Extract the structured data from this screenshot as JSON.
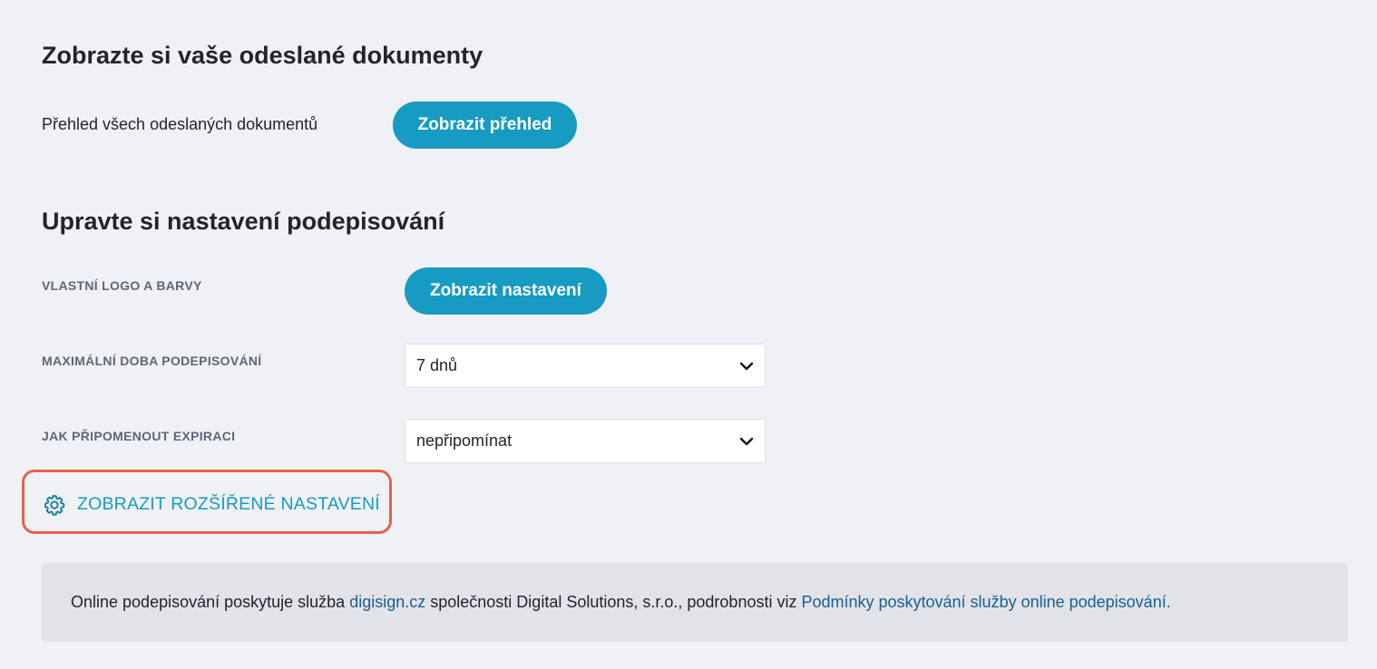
{
  "sent_docs": {
    "title": "Zobrazte si vaše odeslané dokumenty",
    "overview_label": "Přehled všech odeslaných dokumentů",
    "overview_button": "Zobrazit přehled"
  },
  "signing_settings": {
    "title": "Upravte si nastavení podepisování",
    "logo_label": "VLASTNÍ LOGO A BARVY",
    "logo_button": "Zobrazit nastavení",
    "max_duration_label": "MAXIMÁLNÍ DOBA PODEPISOVÁNÍ",
    "max_duration_value": "7 dnů",
    "reminder_label": "JAK PŘIPOMENOUT EXPIRACI",
    "reminder_value": "nepřipomínat",
    "advanced_link": "ZOBRAZIT ROZŠÍŘENÉ NASTAVENÍ"
  },
  "footer": {
    "text_before": "Online podepisování poskytuje služba ",
    "service_link": "digisign.cz",
    "text_middle": " společnosti Digital Solutions, s.r.o., podrobnosti viz ",
    "terms_link": "Podmínky poskytování služby online podepisování."
  },
  "icons": {
    "gear": "gear-icon",
    "chevron": "chevron-down-icon"
  },
  "colors": {
    "accent": "#179bc2",
    "highlight_border": "#e0644f",
    "link": "#1a5e8e",
    "background": "#f0f1f4"
  }
}
